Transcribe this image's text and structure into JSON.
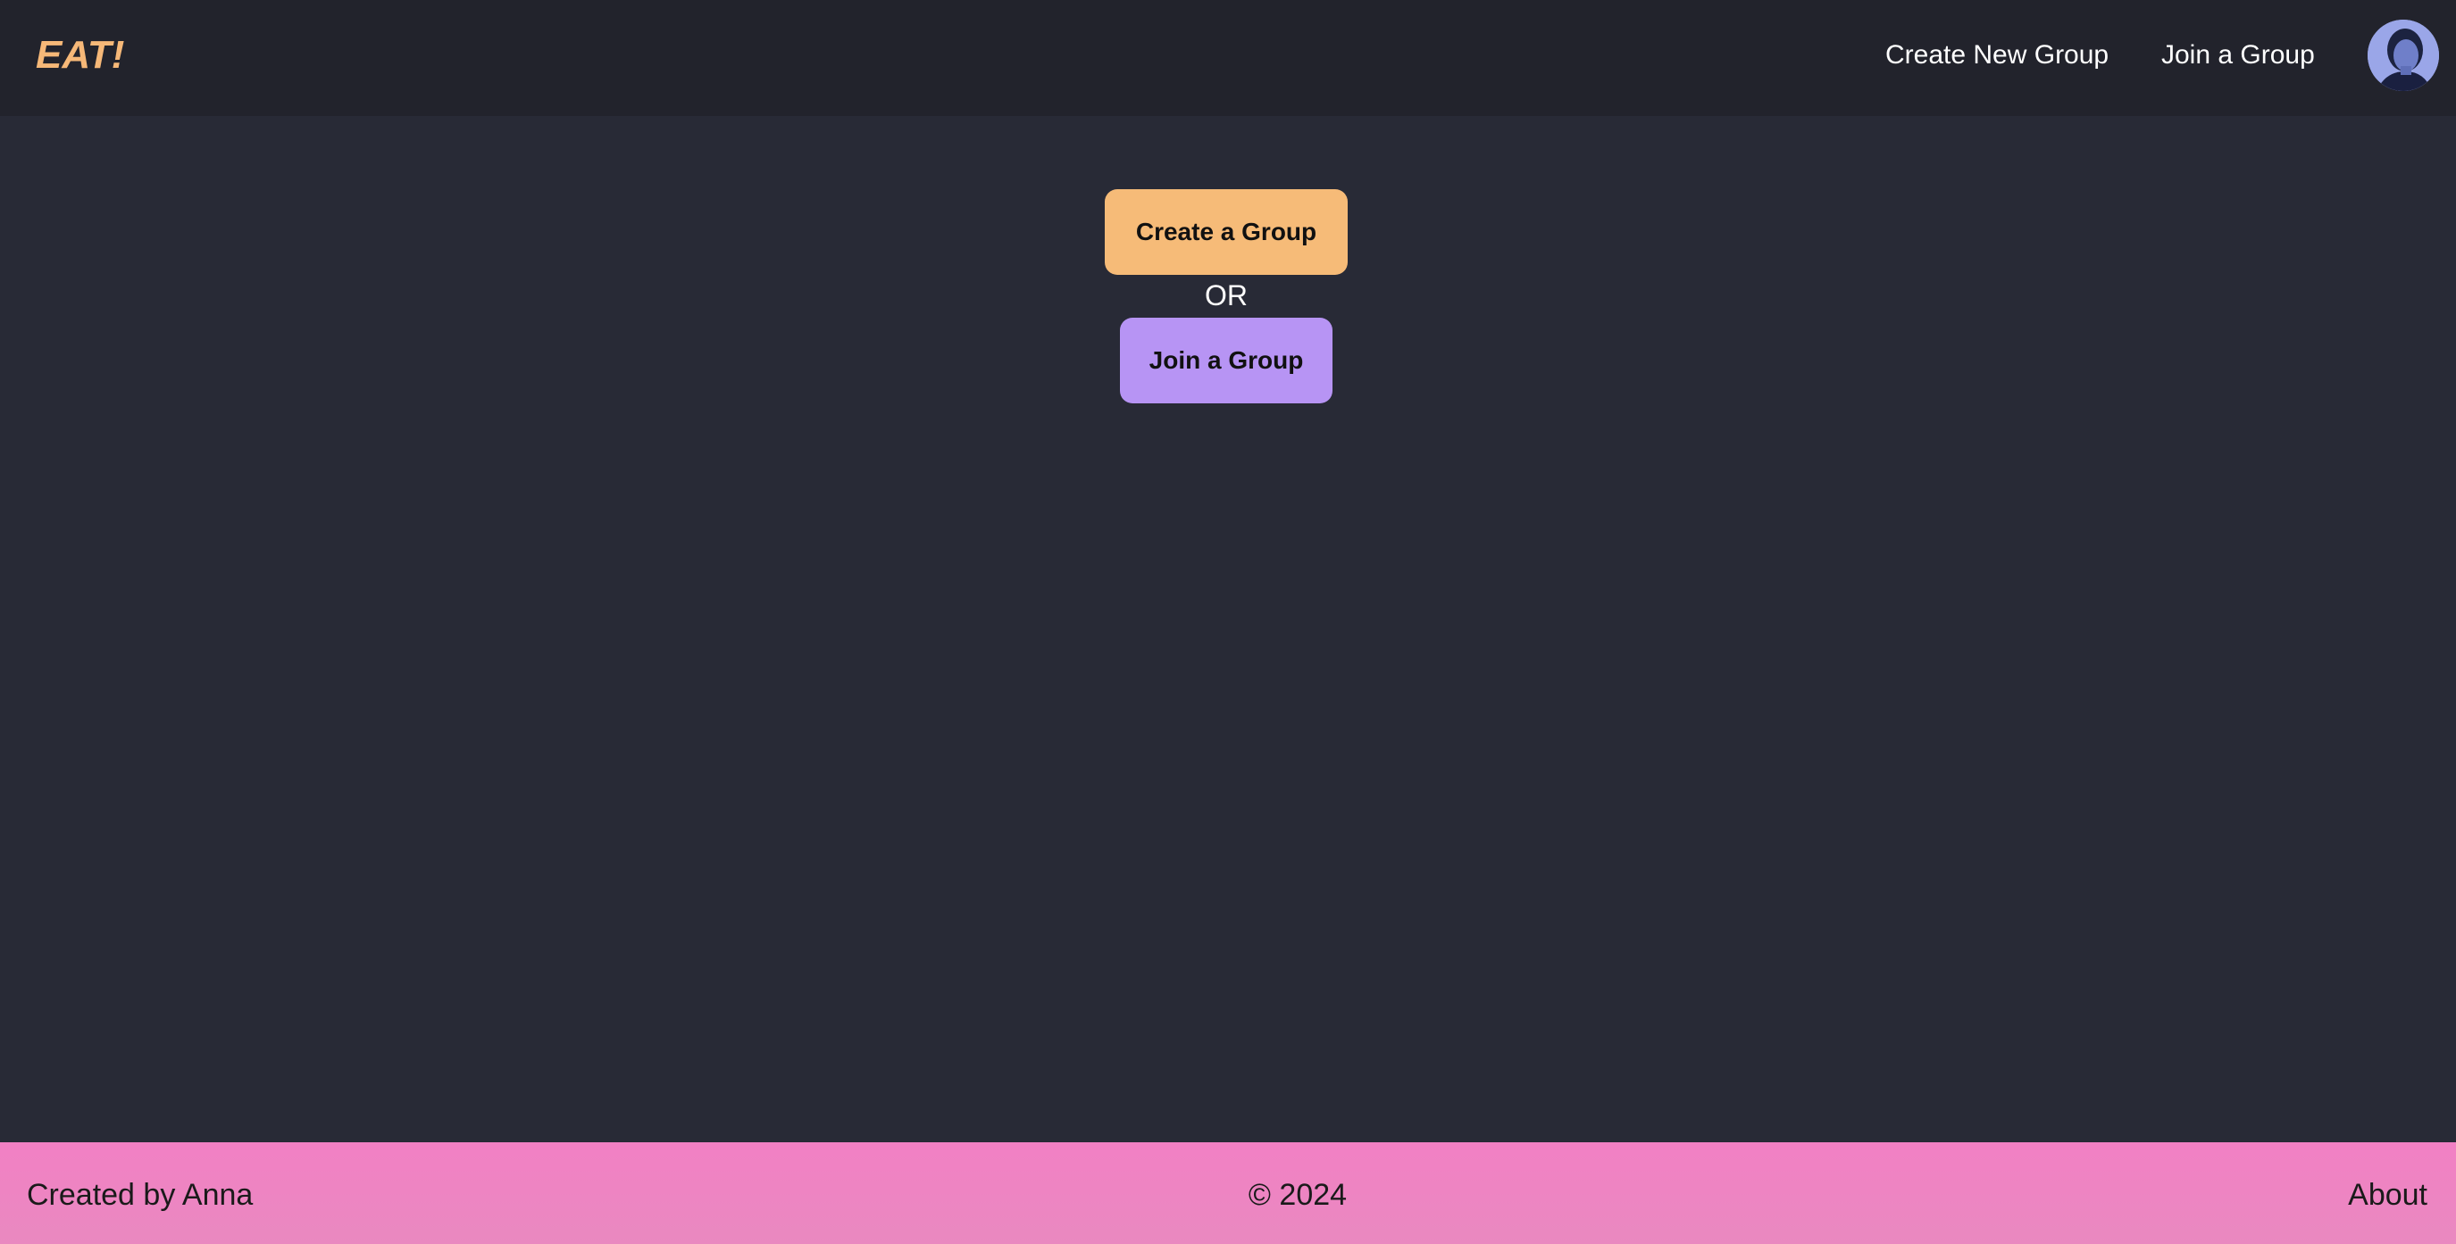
{
  "navbar": {
    "brand": "EAT!",
    "links": {
      "create": "Create New Group",
      "join": "Join a Group"
    },
    "avatar_icon": "user-avatar"
  },
  "main": {
    "create_button": "Create a Group",
    "or_text": "OR",
    "join_button": "Join a Group"
  },
  "footer": {
    "credit": "Created by Anna",
    "copyright": "© 2024",
    "about": "About"
  },
  "colors": {
    "background": "#282a36",
    "navbar": "#22232c",
    "brand": "#f6b878",
    "create_button": "#f6bb78",
    "join_button": "#b794f4",
    "footer": "#f280c4"
  }
}
